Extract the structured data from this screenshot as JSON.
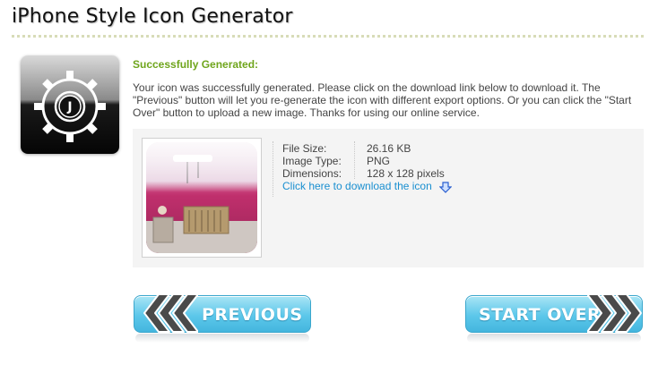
{
  "page": {
    "title": "iPhone Style Icon Generator"
  },
  "result": {
    "heading": "Successfully Generated:",
    "message": "Your icon was successfully generated. Please click on the download link below to download it. The \"Previous\" button will let you re-generate the icon with different export options. Or you can click the \"Start Over\" button to upload a new image. Thanks for using our online service."
  },
  "file_info": {
    "size_label": "File Size:",
    "size_value": "26.16 KB",
    "type_label": "Image Type:",
    "type_value": "PNG",
    "dimensions_label": "Dimensions:",
    "dimensions_value": "128 x 128 pixels",
    "download_link": "Click here to download the icon"
  },
  "buttons": {
    "previous": "PREVIOUS",
    "start_over": "START OVER"
  },
  "icons": {
    "app_logo": "gear-icon",
    "download": "download-arrow-icon",
    "previous": "chevron-left-icon",
    "start_over": "chevron-right-icon"
  },
  "colors": {
    "heading": "#6fa51c",
    "link": "#1a8fd0",
    "button": "#5cc7ea"
  }
}
